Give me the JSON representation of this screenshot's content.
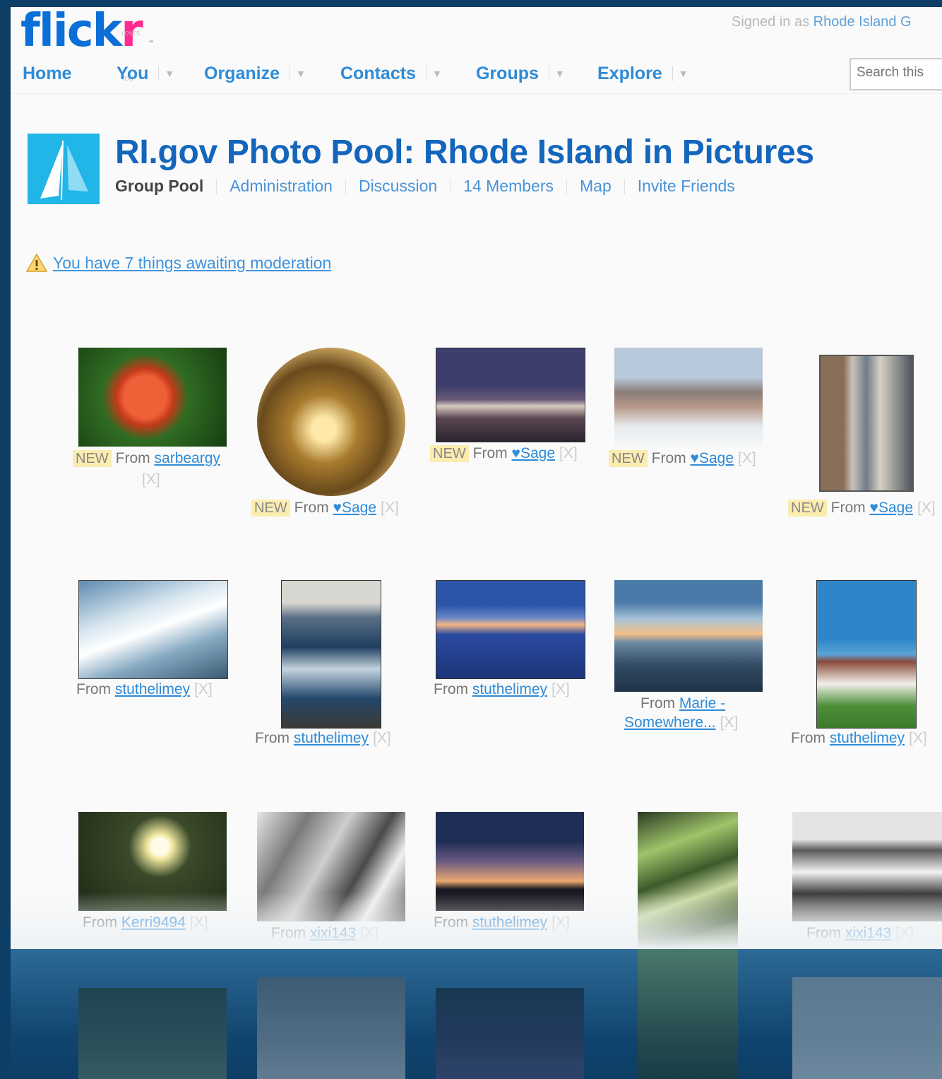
{
  "header": {
    "logo_main": "flick",
    "logo_accent": "r",
    "logo_tm": "™",
    "logo_tagline": "LOVES YOU",
    "signed_in_prefix": "Signed in as",
    "signed_in_user": "Rhode Island G",
    "search_placeholder": "Search this"
  },
  "nav": [
    {
      "label": "Home"
    },
    {
      "label": "You"
    },
    {
      "label": "Organize"
    },
    {
      "label": "Contacts"
    },
    {
      "label": "Groups"
    },
    {
      "label": "Explore"
    }
  ],
  "group": {
    "title": "RI.gov Photo Pool: Rhode Island in Pictures",
    "current_tab": "Group Pool",
    "links": [
      "Administration",
      "Discussion",
      "14 Members",
      "Map",
      "Invite Friends"
    ]
  },
  "moderation_notice": "You have 7 things awaiting moderation",
  "labels": {
    "new": "NEW",
    "from": "From",
    "remove": "[X]"
  },
  "photos": [
    {
      "user": "sarbeargy",
      "new": true
    },
    {
      "user": "♥Sage",
      "new": true
    },
    {
      "user": "♥Sage",
      "new": true
    },
    {
      "user": "♥Sage",
      "new": true
    },
    {
      "user": "♥Sage",
      "new": true
    },
    {
      "user": "stuthelimey",
      "new": false
    },
    {
      "user": "stuthelimey",
      "new": false
    },
    {
      "user": "stuthelimey",
      "new": false
    },
    {
      "user": "Marie - Somewhere...",
      "user_line1": "Marie -",
      "user_line2": "Somewhere...",
      "new": false
    },
    {
      "user": "stuthelimey",
      "new": false
    },
    {
      "user": "Kerri9494",
      "new": false
    },
    {
      "user": "xixi143",
      "new": false
    },
    {
      "user": "stuthelimey",
      "new": false
    },
    {
      "user": "",
      "new": false
    },
    {
      "user": "xixi143",
      "new": false
    }
  ],
  "colors": {
    "accent": "#1466bd",
    "link": "#2e8bd8",
    "flickr_pink": "#ff2d8f",
    "background": "#0d3e66"
  }
}
